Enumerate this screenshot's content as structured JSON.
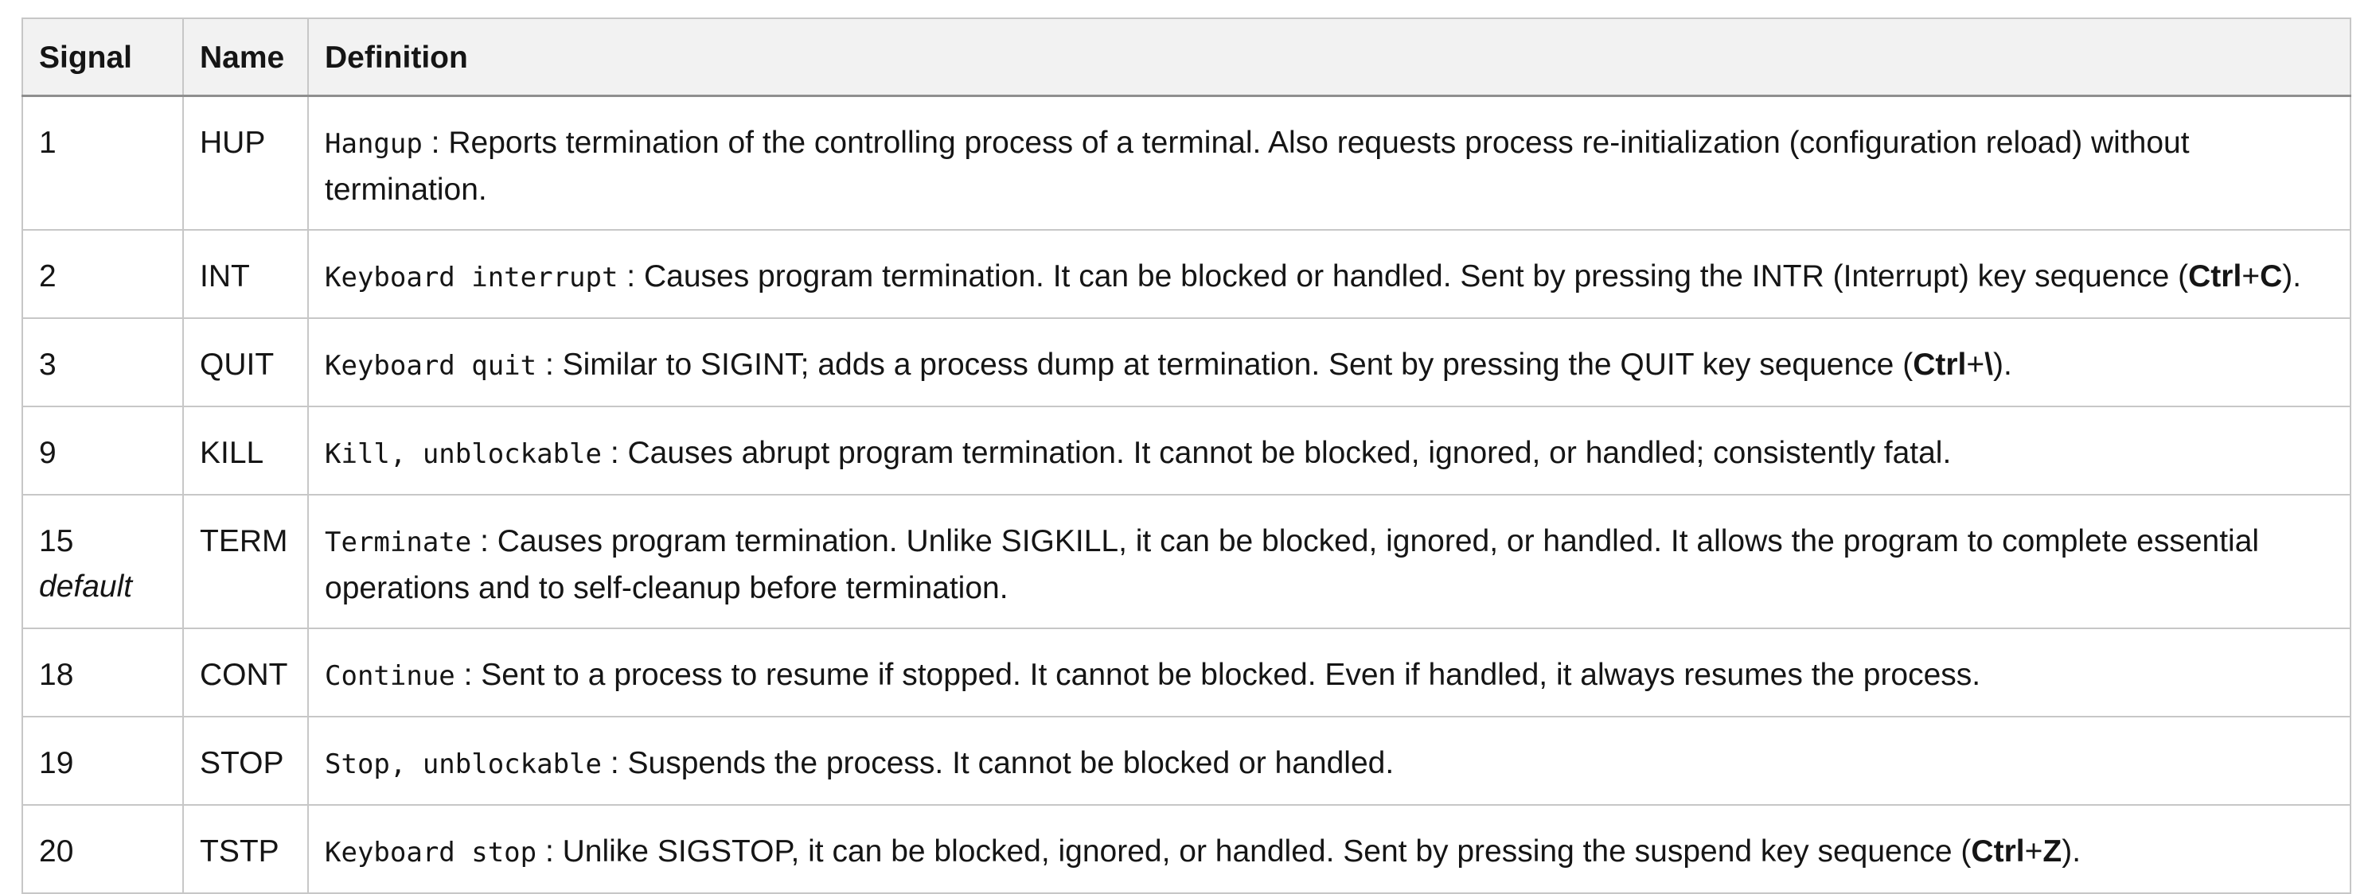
{
  "table": {
    "headers": [
      "Signal",
      "Name",
      "Definition"
    ],
    "rows": [
      {
        "signal": "1",
        "signal_note": "",
        "name": "HUP",
        "code": "Hangup",
        "segments": [
          {
            "text": "Reports termination of the controlling process of a terminal. Also requests process re-initialization (configuration reload) without termination.",
            "bold": false
          }
        ]
      },
      {
        "signal": "2",
        "signal_note": "",
        "name": "INT",
        "code": "Keyboard interrupt",
        "segments": [
          {
            "text": "Causes program termination. It can be blocked or handled. Sent by pressing the INTR (Interrupt) key sequence (",
            "bold": false
          },
          {
            "text": "Ctrl",
            "bold": true
          },
          {
            "text": "+",
            "bold": false
          },
          {
            "text": "C",
            "bold": true
          },
          {
            "text": ").",
            "bold": false
          }
        ]
      },
      {
        "signal": "3",
        "signal_note": "",
        "name": "QUIT",
        "code": "Keyboard quit",
        "segments": [
          {
            "text": "Similar to SIGINT; adds a process dump at termination. Sent by pressing the QUIT key sequence (",
            "bold": false
          },
          {
            "text": "Ctrl",
            "bold": true
          },
          {
            "text": "+",
            "bold": false
          },
          {
            "text": "\\",
            "bold": true
          },
          {
            "text": ").",
            "bold": false
          }
        ]
      },
      {
        "signal": "9",
        "signal_note": "",
        "name": "KILL",
        "code": "Kill, unblockable",
        "segments": [
          {
            "text": "Causes abrupt program termination. It cannot be blocked, ignored, or handled; consistently fatal.",
            "bold": false
          }
        ]
      },
      {
        "signal": "15",
        "signal_note": "default",
        "name": "TERM",
        "code": "Terminate",
        "segments": [
          {
            "text": "Causes program termination. Unlike SIGKILL, it can be blocked, ignored, or handled. It allows the program to complete essential operations and to self-cleanup before termination.",
            "bold": false
          }
        ]
      },
      {
        "signal": "18",
        "signal_note": "",
        "name": "CONT",
        "code": "Continue",
        "segments": [
          {
            "text": "Sent to a process to resume if stopped. It cannot be blocked. Even if handled, it always resumes the process.",
            "bold": false
          }
        ]
      },
      {
        "signal": "19",
        "signal_note": "",
        "name": "STOP",
        "code": "Stop, unblockable",
        "segments": [
          {
            "text": "Suspends the process. It cannot be blocked or handled.",
            "bold": false
          }
        ]
      },
      {
        "signal": "20",
        "signal_note": "",
        "name": "TSTP",
        "code": "Keyboard stop",
        "segments": [
          {
            "text": "Unlike SIGSTOP, it can be blocked, ignored, or handled. Sent by pressing the suspend key sequence (",
            "bold": false
          },
          {
            "text": "Ctrl",
            "bold": true
          },
          {
            "text": "+",
            "bold": false
          },
          {
            "text": "Z",
            "bold": true
          },
          {
            "text": ").",
            "bold": false
          }
        ]
      }
    ],
    "separator": " : "
  }
}
